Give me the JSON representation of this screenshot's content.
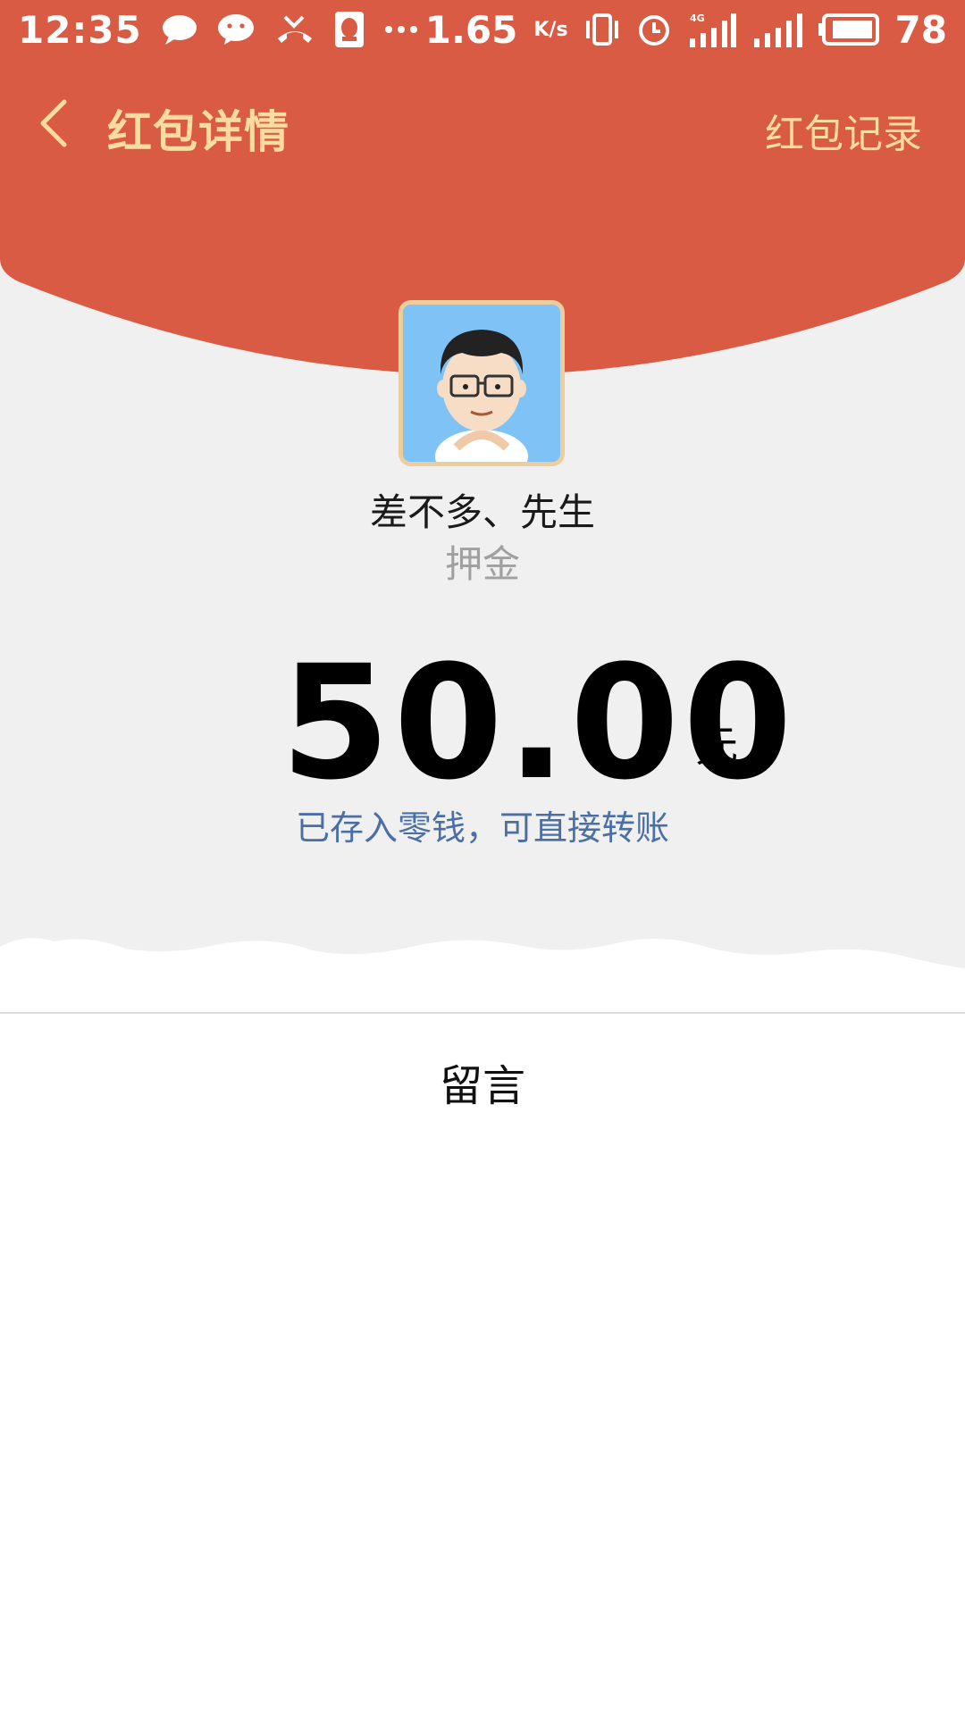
{
  "status_bar": {
    "time": "12:35",
    "net_speed": "1.65",
    "net_speed_unit": "K/s",
    "network": "4G",
    "battery": "78",
    "icons": [
      "chat-bubble-icon",
      "wechat-icon",
      "missed-call-icon",
      "qq-icon",
      "more-dots-icon",
      "vibrate-icon",
      "alarm-icon",
      "signal-icon",
      "signal-icon-2",
      "battery-icon"
    ]
  },
  "nav": {
    "title": "红包详情",
    "record_label": "红包记录"
  },
  "envelope": {
    "sender_name": "差不多、先生",
    "greeting": "押金",
    "amount": "50.00",
    "unit": "元",
    "deposit_note": "已存入零钱，可直接转账"
  },
  "message_section": {
    "label": "留言"
  },
  "colors": {
    "header_red": "#d95b44",
    "nav_gold": "#fbdba0",
    "note_blue": "#4a6fa5",
    "background_grey": "#f0f0f0"
  }
}
